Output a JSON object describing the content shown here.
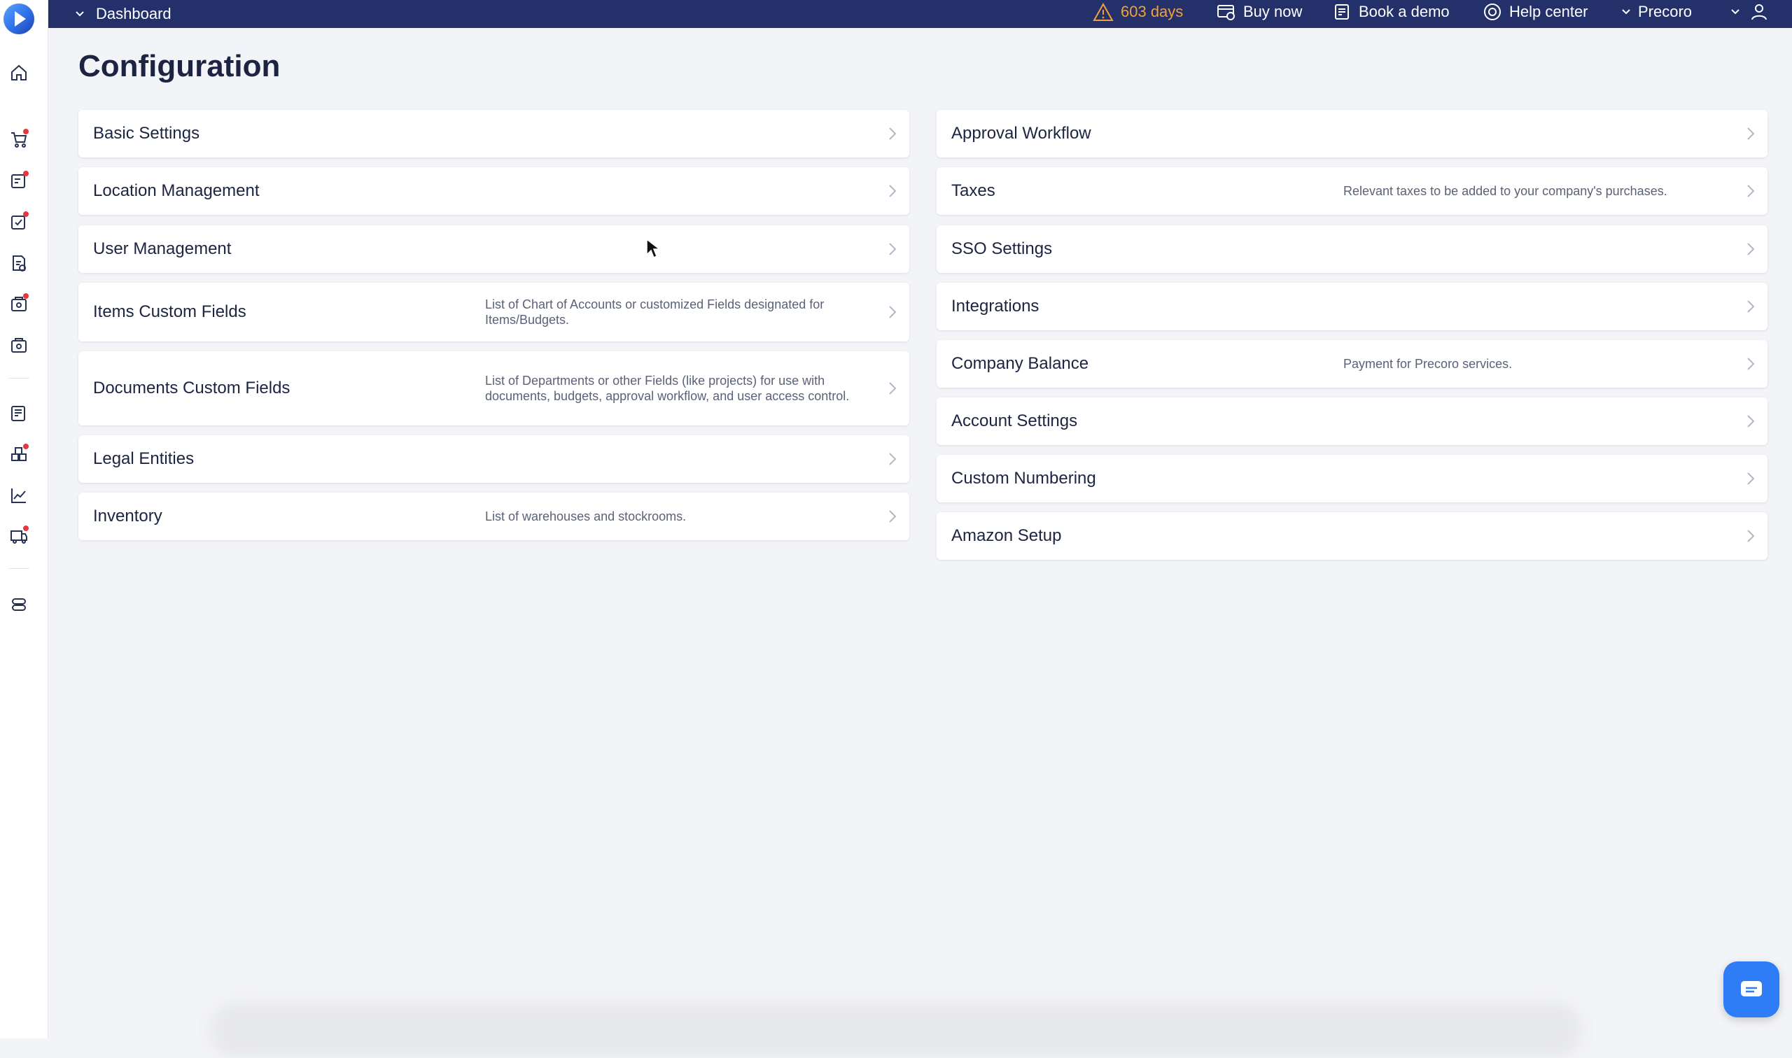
{
  "topbar": {
    "dashboard_label": "Dashboard",
    "trial_days": "603 days",
    "buy_now": "Buy now",
    "book_demo": "Book a demo",
    "help_center": "Help center",
    "company": "Precoro"
  },
  "page": {
    "title": "Configuration"
  },
  "left_column": [
    {
      "title": "Basic Settings",
      "desc": ""
    },
    {
      "title": "Location Management",
      "desc": ""
    },
    {
      "title": "User Management",
      "desc": ""
    },
    {
      "title": "Items Custom Fields",
      "desc": "List of Chart of Accounts or customized Fields designated for Items/Budgets."
    },
    {
      "title": "Documents Custom Fields",
      "desc": "List of Departments or other Fields (like projects) for use with documents, budgets, approval workflow, and user access control."
    },
    {
      "title": "Legal Entities",
      "desc": ""
    },
    {
      "title": "Inventory",
      "desc": "List of warehouses and stockrooms."
    }
  ],
  "right_column": [
    {
      "title": "Approval Workflow",
      "desc": ""
    },
    {
      "title": "Taxes",
      "desc": "Relevant taxes to be added to your company's purchases."
    },
    {
      "title": "SSO Settings",
      "desc": ""
    },
    {
      "title": "Integrations",
      "desc": ""
    },
    {
      "title": "Company Balance",
      "desc": "Payment for Precoro services."
    },
    {
      "title": "Account Settings",
      "desc": ""
    },
    {
      "title": "Custom Numbering",
      "desc": ""
    },
    {
      "title": "Amazon Setup",
      "desc": ""
    }
  ],
  "colors": {
    "topbar": "#23306a",
    "warning": "#f2a13a",
    "badge": "#e8363f",
    "chat": "#2e7df6"
  },
  "icons": [
    "logo-icon",
    "home-icon",
    "cart-icon",
    "requests-icon",
    "approvals-icon",
    "invoices-icon",
    "receipts-icon",
    "payments-icon",
    "budgets-icon",
    "inventory-icon",
    "analytics-icon",
    "suppliers-icon",
    "settings-icon",
    "warning-icon",
    "buy-icon",
    "calendar-icon",
    "help-icon",
    "chevron-down-icon",
    "user-icon",
    "chat-icon",
    "chevron-right-icon"
  ]
}
